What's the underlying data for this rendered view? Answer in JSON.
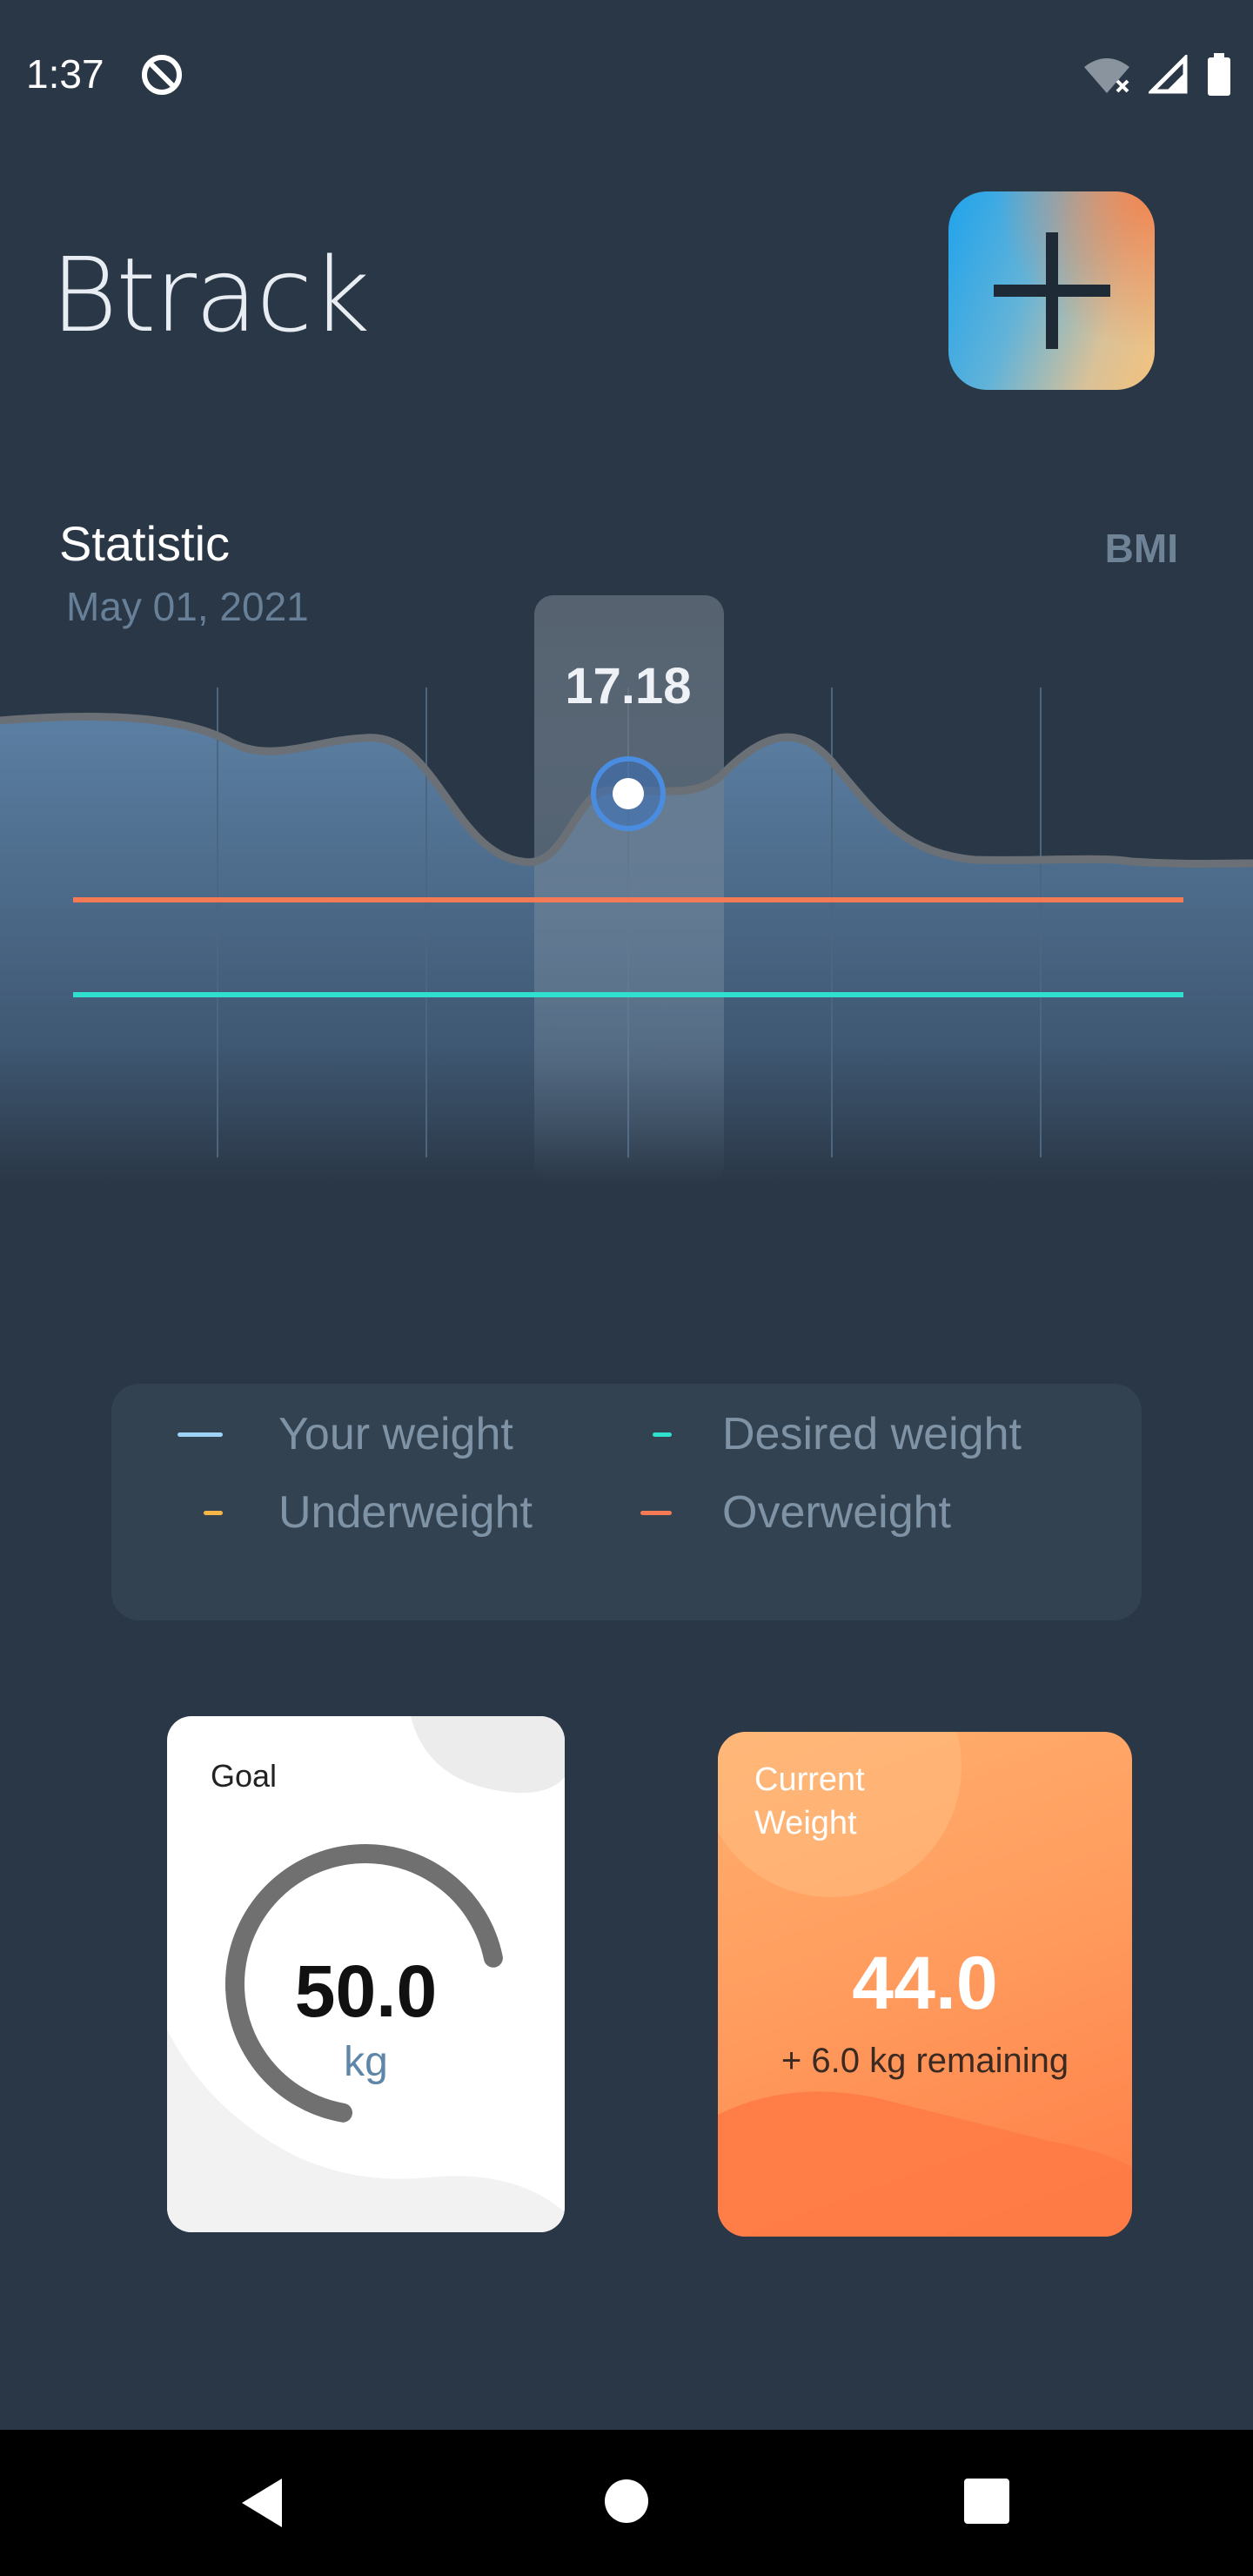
{
  "status_bar": {
    "time": "1:37"
  },
  "header": {
    "app_title": "Btrack"
  },
  "statistic": {
    "title": "Statistic",
    "date": "May 01, 2021",
    "mode": "BMI",
    "tooltip_value": "17.18"
  },
  "legend": {
    "items": [
      {
        "label": "Your weight",
        "color": "#9fd3f5"
      },
      {
        "label": "Desired weight",
        "color": "#2ee0cd"
      },
      {
        "label": "Underweight",
        "color": "#f5b547"
      },
      {
        "label": "Overweight",
        "color": "#f47a56"
      }
    ]
  },
  "goal_card": {
    "title": "Goal",
    "value": "50.0",
    "unit": "kg",
    "progress": 0.75
  },
  "weight_card": {
    "title_line1": "Current",
    "title_line2": "Weight",
    "value": "44.0",
    "remaining": "+ 6.0 kg remaining"
  },
  "colors": {
    "background": "#2a3746",
    "overweight_line": "#f47a56",
    "desired_line": "#2ee0cd",
    "accent_orange": "#ff8a50"
  }
}
